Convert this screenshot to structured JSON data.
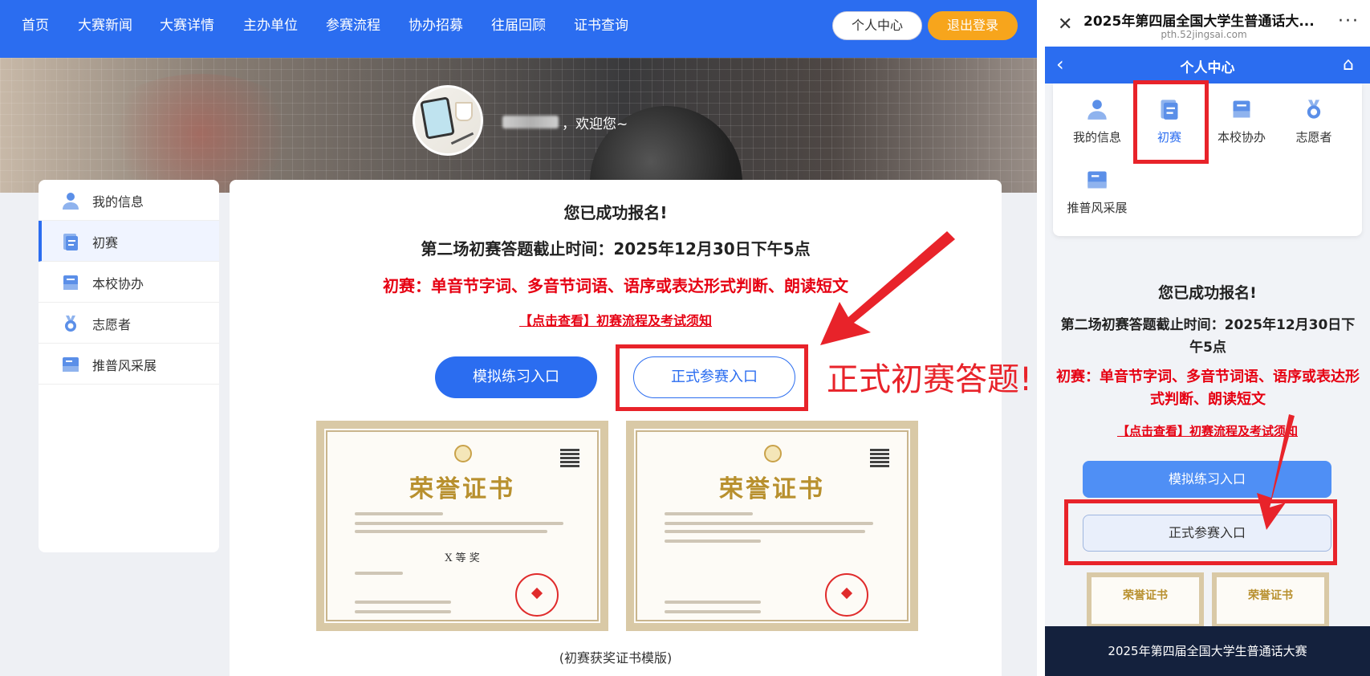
{
  "desktop": {
    "nav": {
      "items": [
        "首页",
        "大赛新闻",
        "大赛详情",
        "主办单位",
        "参赛流程",
        "协办招募",
        "往届回顾",
        "证书查询"
      ],
      "center_button": "个人中心",
      "logout_button": "退出登录"
    },
    "banner": {
      "welcome": "，欢迎您~"
    },
    "sidebar": {
      "items": [
        {
          "label": "我的信息",
          "icon": "user-icon"
        },
        {
          "label": "初赛",
          "icon": "document-icon"
        },
        {
          "label": "本校协办",
          "icon": "cooperation-icon"
        },
        {
          "label": "志愿者",
          "icon": "medal-icon"
        },
        {
          "label": "推普风采展",
          "icon": "showcase-icon"
        }
      ],
      "active_index": 1
    },
    "main": {
      "success": "您已成功报名!",
      "deadline": "第二场初赛答题截止时间：2025年12月30日下午5点",
      "content": "初赛：单音节字词、多音节词语、语序或表达形式判断、朗读短文",
      "link": "【点击查看】初赛流程及考试须知",
      "practice_button": "模拟练习入口",
      "formal_button": "正式参赛入口",
      "certificates": [
        {
          "title": "荣誉证书",
          "award": "X 等 奖"
        },
        {
          "title": "荣誉证书",
          "award": ""
        }
      ],
      "caption": "(初赛获奖证书模版)"
    },
    "annotation": "正式初赛答题!"
  },
  "mobile": {
    "topbar": {
      "close": "✕",
      "title": "2025年第四届全国大学生普通话大...",
      "url": "pth.52jingsai.com",
      "more": "···"
    },
    "header": {
      "back": "‹",
      "title": "个人中心",
      "home": "⌂"
    },
    "menu": [
      {
        "label": "我的信息",
        "icon": "user-icon"
      },
      {
        "label": "初赛",
        "icon": "document-icon"
      },
      {
        "label": "本校协办",
        "icon": "cooperation-icon"
      },
      {
        "label": "志愿者",
        "icon": "medal-icon"
      },
      {
        "label": "推普风采展",
        "icon": "showcase-icon"
      }
    ],
    "success": "您已成功报名!",
    "deadline": "第二场初赛答题截止时间：2025年12月30日下午5点",
    "content": "初赛：单音节字词、多音节词语、语序或表达形式判断、朗读短文",
    "link": "【点击查看】初赛流程及考试须知",
    "practice_button": "模拟练习入口",
    "formal_button": "正式参赛入口",
    "cert_title": "荣誉证书",
    "footer": "2025年第四届全国大学生普通话大赛"
  },
  "colors": {
    "primary": "#2b6df0",
    "accent_orange": "#f7a51c",
    "highlight_red": "#e8232a",
    "text_red": "#e60012",
    "footer_dark": "#14213d"
  }
}
